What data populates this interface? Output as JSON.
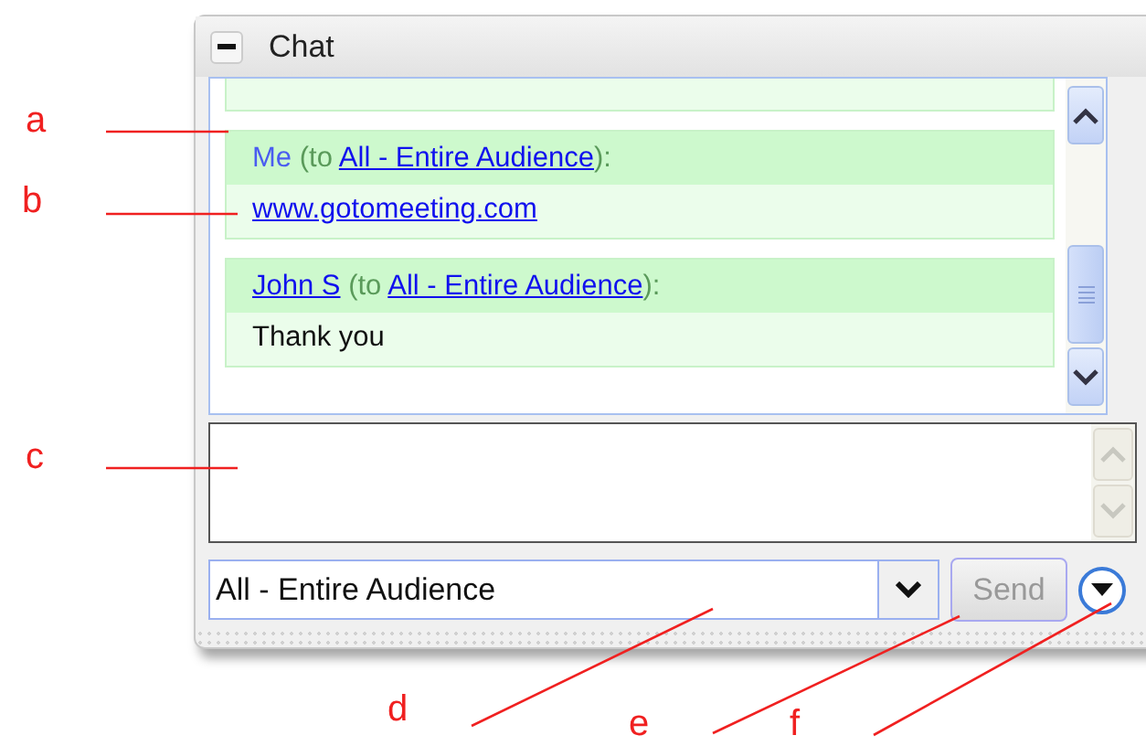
{
  "panel": {
    "title": "Chat",
    "collapsed": false
  },
  "messages": [
    {
      "kind": "clipped"
    },
    {
      "kind": "message",
      "sender": "Me",
      "sender_linked": false,
      "to_prefix": "(to ",
      "recipient": "All - Entire Audience",
      "suffix": "):",
      "body": "www.gotomeeting.com",
      "body_linked": true
    },
    {
      "kind": "message",
      "sender": "John S",
      "sender_linked": true,
      "to_prefix": "(to ",
      "recipient": "All - Entire Audience",
      "suffix": "):",
      "body": "Thank you",
      "body_linked": false
    }
  ],
  "recipient_select": {
    "value": "All - Entire Audience"
  },
  "send_button": {
    "label": "Send",
    "disabled": true
  },
  "annotations": [
    {
      "letter": "a"
    },
    {
      "letter": "b"
    },
    {
      "letter": "c"
    },
    {
      "letter": "d"
    },
    {
      "letter": "e"
    },
    {
      "letter": "f"
    }
  ]
}
